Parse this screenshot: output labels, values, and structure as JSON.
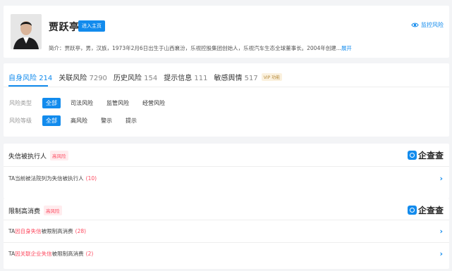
{
  "profile": {
    "name": "贾跃亭",
    "home_button": "进入主页",
    "monitor_label": "监控风险",
    "intro": "简介：贾跃亭，男，汉族，1973年2月6日出生于山西襄汾，乐视控股集团创始人，乐视汽车生态全球董事长。2004年创建...",
    "expand_label": "展开"
  },
  "risk_tabs": [
    {
      "label": "自身风险",
      "count": "214"
    },
    {
      "label": "关联风险",
      "count": "7290"
    },
    {
      "label": "历史风险",
      "count": "154"
    },
    {
      "label": "提示信息",
      "count": "111"
    },
    {
      "label": "敏感舆情",
      "count": "517"
    }
  ],
  "vip_badge": "VIP 功能",
  "filters": {
    "type_label": "风险类型",
    "type_options": [
      "全部",
      "司法风险",
      "监管风险",
      "经营风险"
    ],
    "level_label": "风险等级",
    "level_options": [
      "全部",
      "高风险",
      "警示",
      "提示"
    ]
  },
  "brand_text": "企查查",
  "sections": [
    {
      "title": "失信被执行人",
      "tag": "高风险",
      "rows": [
        {
          "prefix": "TA当前被法院列为失信被执行人",
          "highlight": "",
          "suffix": "",
          "count": "(10)"
        }
      ]
    },
    {
      "title": "限制高消费",
      "tag": "高风险",
      "rows": [
        {
          "prefix": "TA",
          "highlight": "因自身失信",
          "suffix": "被限制高消费",
          "count": "(28)"
        },
        {
          "prefix": "TA",
          "highlight": "因关联企业失信",
          "suffix": "被限制高消费",
          "count": "(2)"
        }
      ]
    }
  ],
  "colors": {
    "accent": "#128bed",
    "danger": "#fd485e"
  }
}
